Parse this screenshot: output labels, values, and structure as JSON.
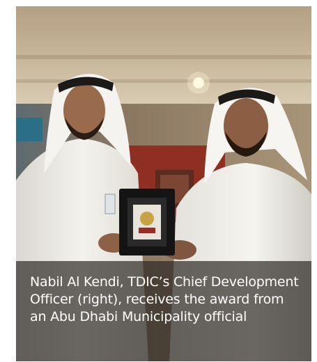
{
  "photo": {
    "subject": "award-presentation-photo",
    "palette": {
      "ceiling": "#c9b89a",
      "wall_warm": "#8a6a4a",
      "wall_red": "#8e2f22",
      "thobe": "#f2f0ea",
      "ghutra": "#f7f6f2",
      "agal": "#1c1a19",
      "skin": "#9a6a4c",
      "plaque": "#141414",
      "plaque_gold": "#c8a243"
    }
  },
  "caption": {
    "text": "Nabil Al Kendi, TDIC’s Chief Development Officer (right), receives the award from an Abu Dhabi Municipality official",
    "background": "rgba(40,36,32,0.68)",
    "color": "#ffffff"
  }
}
